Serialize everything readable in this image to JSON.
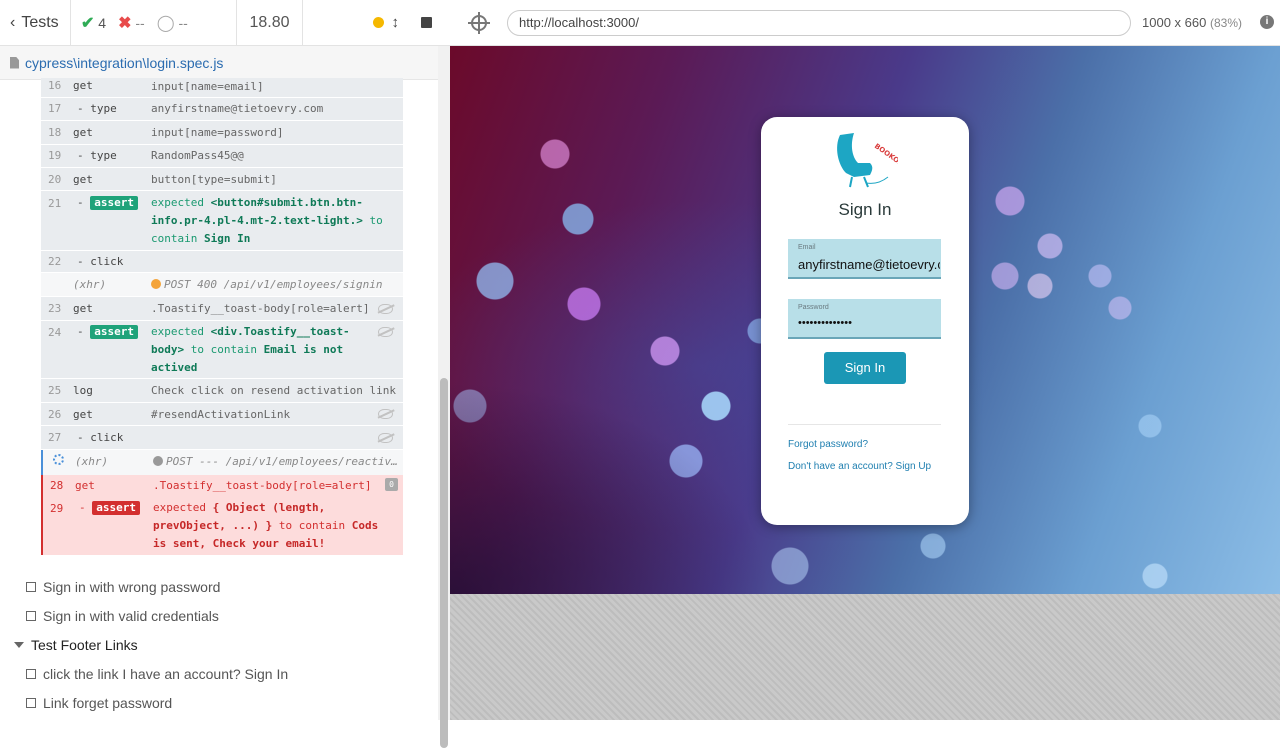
{
  "reporter": {
    "tests_label": "Tests",
    "passed": "4",
    "failed": "--",
    "pending": "--",
    "duration": "18.80"
  },
  "spec": {
    "path": "cypress\\integration\\login.spec.js"
  },
  "commands": [
    {
      "num": "16",
      "name": "get",
      "msg": "input[name=email]"
    },
    {
      "num": "17",
      "name": "- type",
      "msg": "anyfirstname@tietoevry.com"
    },
    {
      "num": "18",
      "name": "get",
      "msg": "input[name=password]"
    },
    {
      "num": "19",
      "name": "- type",
      "msg": "RandomPass45@@"
    },
    {
      "num": "20",
      "name": "get",
      "msg": "button[type=submit]"
    },
    {
      "num": "21",
      "name": "- assert",
      "msg_parts": [
        "expected",
        "<button#submit.btn.btn-info.pr-4.pl-4.mt-2.text-light.>",
        "to contain",
        "Sign In"
      ]
    },
    {
      "num": "22",
      "name": "- click",
      "msg": ""
    },
    {
      "num": "",
      "name": "(xhr)",
      "msg": "POST 400 /api/v1/employees/signin"
    },
    {
      "num": "23",
      "name": "get",
      "msg": ".Toastify__toast-body[role=alert]"
    },
    {
      "num": "24",
      "name": "- assert",
      "msg_parts": [
        "expected",
        "<div.Toastify__toast-body>",
        "to contain",
        "Email is not actived"
      ]
    },
    {
      "num": "25",
      "name": "log",
      "msg": "Check click on resend activation link"
    },
    {
      "num": "26",
      "name": "get",
      "msg": "#resendActivationLink"
    },
    {
      "num": "27",
      "name": "- click",
      "msg": ""
    },
    {
      "num": "",
      "name": "(xhr)",
      "msg": "POST --- /api/v1/employees/reactiv…"
    },
    {
      "num": "28",
      "name": "get",
      "msg": ".Toastify__toast-body[role=alert]",
      "count": "0"
    },
    {
      "num": "29",
      "name": "- assert",
      "msg_parts": [
        "expected",
        "{ Object (length, prevObject, ...) }",
        "to contain",
        "Cods is sent, Check your email!"
      ]
    }
  ],
  "tests": [
    {
      "label": "Sign in with wrong password"
    },
    {
      "label": "Sign in with valid credentials"
    },
    {
      "label": "Test Footer Links"
    },
    {
      "label": "click the link I have an account? Sign In"
    },
    {
      "label": "Link forget password"
    }
  ],
  "preview": {
    "url": "http://localhost:3000/",
    "viewport": "1000 x 660",
    "scale": "(83%)",
    "info": "i"
  },
  "login": {
    "logo_text": "BOOKORA",
    "title": "Sign In",
    "email_label": "Email",
    "email_value": "anyfirstname@tietoevry.com",
    "password_label": "Password",
    "password_value": "••••••••••••••",
    "button": "Sign In",
    "forgot_link": "Forgot password?",
    "signup_link": "Don't have an account? Sign Up"
  },
  "colors": {
    "pass": "#2fac56",
    "fail": "#e84b4b",
    "accent": "#1b97b5",
    "assert_badge": "#1fa37a"
  }
}
